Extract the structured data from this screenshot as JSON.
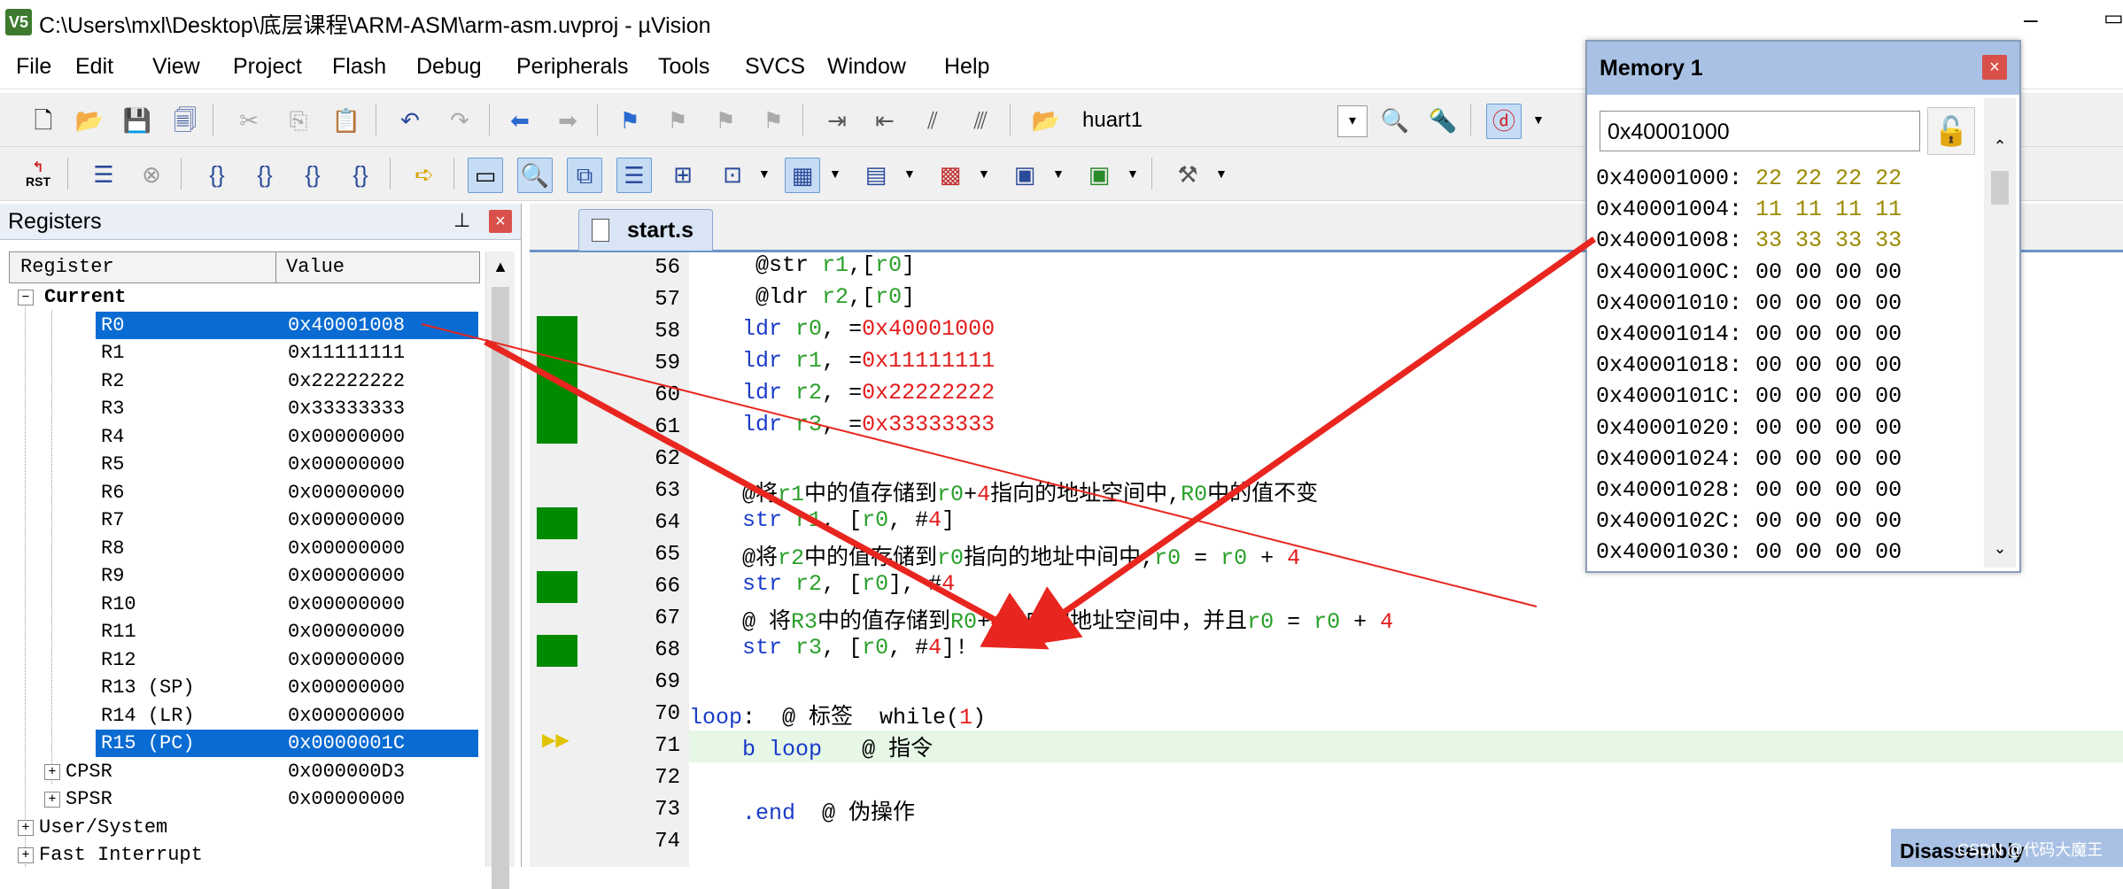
{
  "window": {
    "app_icon": "V5",
    "title": "C:\\Users\\mxl\\Desktop\\底层课程\\ARM-ASM\\arm-asm.uvproj - µVision",
    "minimize_glyph": "–",
    "maximize_glyph": "▭"
  },
  "menu": [
    "File",
    "Edit",
    "View",
    "Project",
    "Flash",
    "Debug",
    "Peripherals",
    "Tools",
    "SVCS",
    "Window",
    "Help"
  ],
  "toolbar1": {
    "target_label": "huart1"
  },
  "icons": {
    "new": "new-file-icon",
    "open": "open-folder-icon",
    "save": "save-icon",
    "save_all": "save-all-icon",
    "cut": "cut-icon",
    "copy": "copy-icon",
    "paste": "paste-icon",
    "undo": "undo-icon",
    "redo": "redo-icon",
    "back": "nav-back-icon",
    "forward": "nav-forward-icon",
    "bookmark": "bookmark-icon",
    "indent": "indent-icon",
    "unindent": "unindent-icon",
    "comment": "comment-icon",
    "uncomment": "uncomment-icon",
    "find_in_files": "find-in-files-icon",
    "debug_session": "debug-session-icon"
  },
  "toolbar2": {
    "reset_label": "RST"
  },
  "registers_panel": {
    "title": "Registers",
    "pin_glyph": "⊥",
    "close_glyph": "×",
    "col_register": "Register",
    "col_value": "Value",
    "group_current": "Current",
    "rows": [
      {
        "name": "R0",
        "value": "0x40001008",
        "selected": true
      },
      {
        "name": "R1",
        "value": "0x11111111"
      },
      {
        "name": "R2",
        "value": "0x22222222"
      },
      {
        "name": "R3",
        "value": "0x33333333"
      },
      {
        "name": "R4",
        "value": "0x00000000"
      },
      {
        "name": "R5",
        "value": "0x00000000"
      },
      {
        "name": "R6",
        "value": "0x00000000"
      },
      {
        "name": "R7",
        "value": "0x00000000"
      },
      {
        "name": "R8",
        "value": "0x00000000"
      },
      {
        "name": "R9",
        "value": "0x00000000"
      },
      {
        "name": "R10",
        "value": "0x00000000"
      },
      {
        "name": "R11",
        "value": "0x00000000"
      },
      {
        "name": "R12",
        "value": "0x00000000"
      },
      {
        "name": "R13 (SP)",
        "value": "0x00000000"
      },
      {
        "name": "R14 (LR)",
        "value": "0x00000000"
      },
      {
        "name": "R15 (PC)",
        "value": "0x0000001C",
        "selected": true
      }
    ],
    "cpsr": {
      "name": "CPSR",
      "value": "0x000000D3"
    },
    "spsr": {
      "name": "SPSR",
      "value": "0x00000000"
    },
    "group_user": "User/System",
    "group_fiq": "Fast Interrupt"
  },
  "editor": {
    "tab_label": "start.s",
    "line_numbers": [
      "56",
      "57",
      "58",
      "59",
      "60",
      "61",
      "62",
      "63",
      "64",
      "65",
      "66",
      "67",
      "68",
      "69",
      "70",
      "71",
      "72",
      "73",
      "74"
    ],
    "covered_lines": [
      58,
      59,
      60,
      61,
      64,
      66,
      68
    ]
  },
  "memory_window": {
    "title": "Memory 1",
    "close_glyph": "×",
    "address_input": "0x40001000",
    "lines": [
      {
        "addr": "0x40001000:",
        "bytes": "22 22 22 22",
        "changed": true
      },
      {
        "addr": "0x40001004:",
        "bytes": "11 11 11 11",
        "changed": true
      },
      {
        "addr": "0x40001008:",
        "bytes": "33 33 33 33",
        "changed": true
      },
      {
        "addr": "0x4000100C:",
        "bytes": "00 00 00 00"
      },
      {
        "addr": "0x40001010:",
        "bytes": "00 00 00 00"
      },
      {
        "addr": "0x40001014:",
        "bytes": "00 00 00 00"
      },
      {
        "addr": "0x40001018:",
        "bytes": "00 00 00 00"
      },
      {
        "addr": "0x4000101C:",
        "bytes": "00 00 00 00"
      },
      {
        "addr": "0x40001020:",
        "bytes": "00 00 00 00"
      },
      {
        "addr": "0x40001024:",
        "bytes": "00 00 00 00"
      },
      {
        "addr": "0x40001028:",
        "bytes": "00 00 00 00"
      },
      {
        "addr": "0x4000102C:",
        "bytes": "00 00 00 00"
      },
      {
        "addr": "0x40001030:",
        "bytes": "00 00 00 00"
      }
    ]
  },
  "disassembly_tab": "Disassembly",
  "watermark": "CSDN @代码大魔王",
  "colors": {
    "selection": "#0a6bd2",
    "coverage_green": "#008a00",
    "keyword_blue": "#1a3cc8",
    "register_green": "#2aa02a",
    "number_red": "#e31c1c",
    "annotation_red": "#e8261f",
    "memory_header": "#a9c1e4"
  }
}
